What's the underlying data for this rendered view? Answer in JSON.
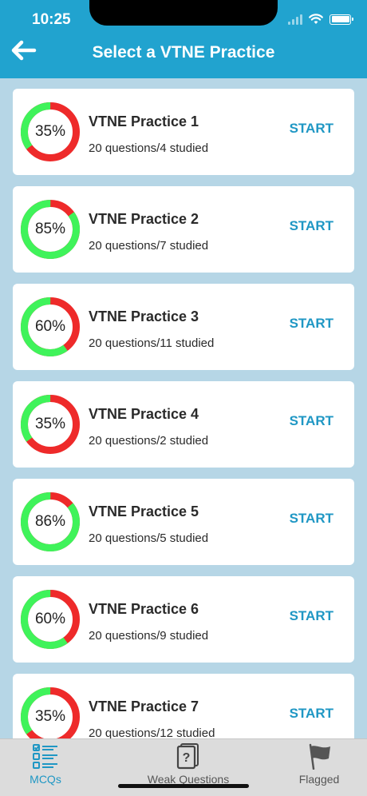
{
  "status_bar": {
    "time": "10:25"
  },
  "header": {
    "title": "Select a VTNE Practice"
  },
  "practices": [
    {
      "percent": 35,
      "percent_label": "35%",
      "title": "VTNE Practice 1",
      "subtitle": "20 questions/4 studied",
      "action": "START"
    },
    {
      "percent": 85,
      "percent_label": "85%",
      "title": "VTNE Practice 2",
      "subtitle": "20 questions/7 studied",
      "action": "START"
    },
    {
      "percent": 60,
      "percent_label": "60%",
      "title": "VTNE Practice 3",
      "subtitle": "20 questions/11 studied",
      "action": "START"
    },
    {
      "percent": 35,
      "percent_label": "35%",
      "title": "VTNE Practice 4",
      "subtitle": "20 questions/2 studied",
      "action": "START"
    },
    {
      "percent": 86,
      "percent_label": "86%",
      "title": "VTNE Practice 5",
      "subtitle": "20 questions/5 studied",
      "action": "START"
    },
    {
      "percent": 60,
      "percent_label": "60%",
      "title": "VTNE Practice 6",
      "subtitle": "20 questions/9 studied",
      "action": "START"
    },
    {
      "percent": 35,
      "percent_label": "35%",
      "title": "VTNE Practice 7",
      "subtitle": "20 questions/12 studied",
      "action": "START"
    }
  ],
  "colors": {
    "header": "#21a3cf",
    "ring_good": "#3ff35a",
    "ring_bad": "#ee2a2a",
    "accent": "#1f97c4",
    "background": "#b6d6e6"
  },
  "tabbar": {
    "tabs": [
      {
        "label": "MCQs",
        "icon": "checklist-icon",
        "active": true
      },
      {
        "label": "Weak Questions",
        "icon": "question-card-icon",
        "active": false
      },
      {
        "label": "Flagged",
        "icon": "flag-icon",
        "active": false
      }
    ]
  }
}
